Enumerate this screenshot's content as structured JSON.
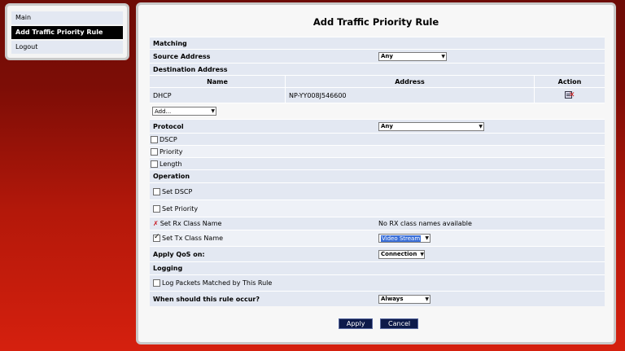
{
  "nav": {
    "items": [
      {
        "label": "Main",
        "active": false
      },
      {
        "label": "Add Traffic Priority Rule",
        "active": true
      },
      {
        "label": "Logout",
        "active": false
      }
    ]
  },
  "page": {
    "title": "Add Traffic Priority Rule"
  },
  "matching": {
    "header": "Matching",
    "source_label": "Source Address",
    "source_value": "Any",
    "dest_header": "Destination Address",
    "columns": [
      "Name",
      "Address",
      "Action"
    ],
    "rows": [
      {
        "name": "DHCP",
        "address": "NP-YY008J546600",
        "action_icon": "delete-icon"
      }
    ],
    "add_value": "Add..."
  },
  "protocol": {
    "label": "Protocol",
    "value": "Any",
    "options": [
      {
        "label": "DSCP",
        "checked": false
      },
      {
        "label": "Priority",
        "checked": false
      },
      {
        "label": "Length",
        "checked": false
      }
    ]
  },
  "operation": {
    "header": "Operation",
    "set_dscp": "Set DSCP",
    "set_priority": "Set Priority",
    "rx_label": "Set Rx Class Name",
    "rx_status": "No RX class names available",
    "tx_label": "Set Tx Class Name",
    "tx_value": "Video Stream"
  },
  "qos": {
    "label": "Apply QoS on:",
    "value": "Connection"
  },
  "logging": {
    "header": "Logging",
    "log_label": "Log Packets Matched by This Rule"
  },
  "schedule": {
    "label": "When should this rule occur?",
    "value": "Always"
  },
  "buttons": {
    "apply": "Apply",
    "cancel": "Cancel"
  },
  "colors": {
    "row_bg": "#e3e8f2",
    "button_bg": "#0d1a4a",
    "highlight": "#3a6fd8"
  }
}
